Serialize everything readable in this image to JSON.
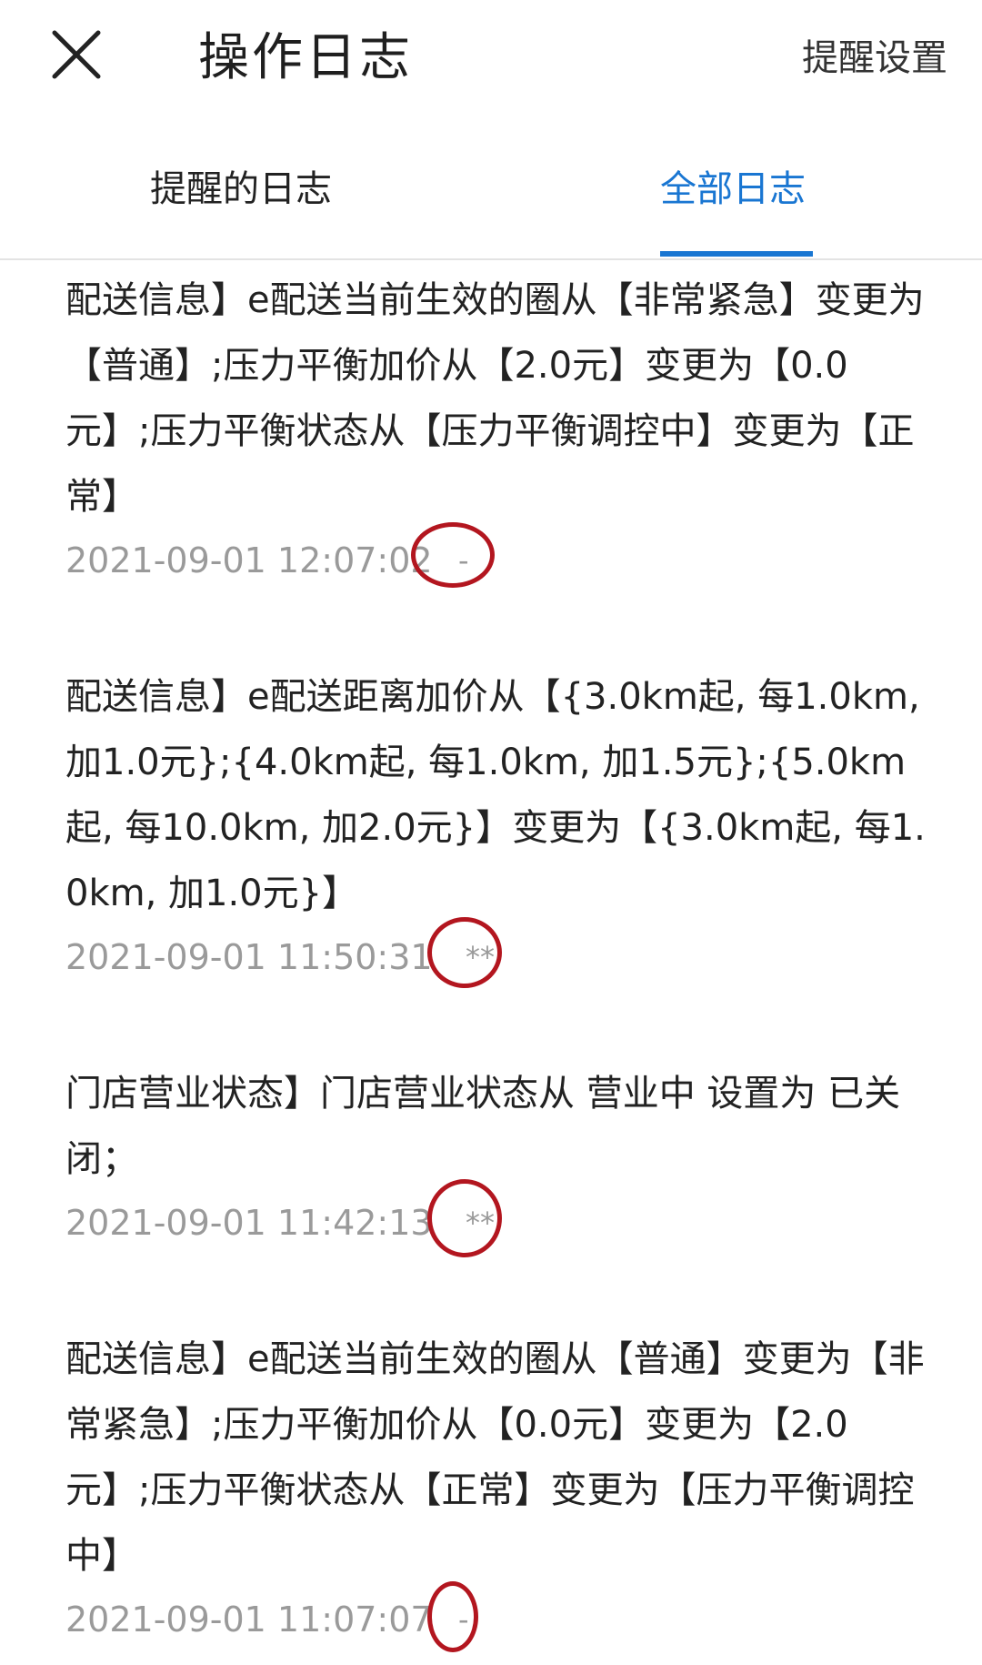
{
  "header": {
    "close_icon": "close-icon",
    "title": "操作日志",
    "settings_label": "提醒设置"
  },
  "tabs": [
    {
      "label": "提醒的日志",
      "active": false
    },
    {
      "label": "全部日志",
      "active": true
    }
  ],
  "colors": {
    "accent": "#1976d2",
    "annotation": "#b3161f"
  },
  "logs": [
    {
      "text": "配送信息】e配送当前生效的圈从【非常紧急】变更为【普通】;压力平衡加价从【2.0元】变更为【0.0元】;压力平衡状态从【压力平衡调控中】变更为【正常】",
      "time": "2021-09-01 12:07:02",
      "operator": "-"
    },
    {
      "text": "配送信息】e配送距离加价从【{3.0km起, 每1.0km, 加1.0元};{4.0km起, 每1.0km, 加1.5元};{5.0km起, 每10.0km, 加2.0元}】变更为【{3.0km起, 每1.0km, 加1.0元}】",
      "time": "2021-09-01 11:50:31",
      "operator": "**"
    },
    {
      "text": "门店营业状态】门店营业状态从 营业中 设置为 已关闭；",
      "time": "2021-09-01 11:42:13",
      "operator": "**"
    },
    {
      "text": "配送信息】e配送当前生效的圈从【普通】变更为【非常紧急】;压力平衡加价从【0.0元】变更为【2.0元】;压力平衡状态从【正常】变更为【压力平衡调控中】",
      "time": "2021-09-01 11:07:07",
      "operator": "-"
    }
  ]
}
